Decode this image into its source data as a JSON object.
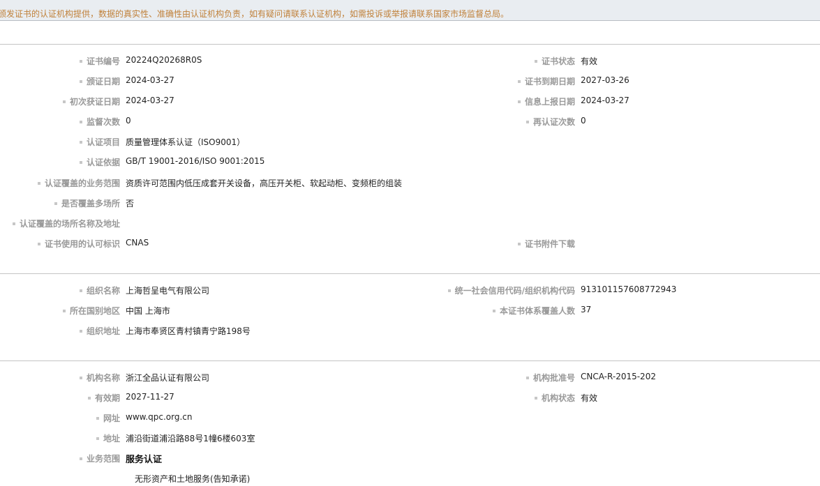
{
  "notice": "颁发证书的认证机构提供，数据的真实性、准确性由认证机构负责，如有疑问请联系认证机构，如需投诉或举报请联系国家市场监督总局。",
  "certificate": {
    "cert_no_label": "证书编号",
    "cert_no": "20224Q20268R0S",
    "status_label": "证书状态",
    "status": "有效",
    "issue_date_label": "颁证日期",
    "issue_date": "2024-03-27",
    "expiry_label": "证书到期日期",
    "expiry": "2027-03-26",
    "first_date_label": "初次获证日期",
    "first_date": "2024-03-27",
    "report_date_label": "信息上报日期",
    "report_date": "2024-03-27",
    "supervision_label": "监督次数",
    "supervision": "0",
    "recert_label": "再认证次数",
    "recert": "0",
    "project_label": "认证项目",
    "project": "质量管理体系认证（ISO9001）",
    "basis_label": "认证依据",
    "basis": "GB/T 19001-2016/ISO 9001:2015",
    "scope_label": "认证覆盖的业务范围",
    "scope": "资质许可范围内低压成套开关设备，高压开关柜、软起动柜、变频柜的组装",
    "multi_site_label": "是否覆盖多场所",
    "multi_site": "否",
    "sites_label": "认证覆盖的场所名称及地址",
    "sites": "",
    "accreditation_label": "证书使用的认可标识",
    "accreditation": "CNAS",
    "attachment_label": "证书附件下载"
  },
  "organization": {
    "name_label": "组织名称",
    "name": "上海哲呈电气有限公司",
    "credit_label": "统一社会信用代码/组织机构代码",
    "credit": "913101157608772943",
    "region_label": "所在国别地区",
    "region": "中国 上海市",
    "headcount_label": "本证书体系覆盖人数",
    "headcount": "37",
    "address_label": "组织地址",
    "address": "上海市奉贤区青村镇青宁路198号"
  },
  "agency": {
    "name_label": "机构名称",
    "name": "浙江全品认证有限公司",
    "approval_label": "机构批准号",
    "approval": "CNCA-R-2015-202",
    "valid_label": "有效期",
    "valid": "2027-11-27",
    "status_label": "机构状态",
    "status": "有效",
    "website_label": "网址",
    "website": "www.qpc.org.cn",
    "address_label": "地址",
    "address": "浦沿街道浦沿路88号1幢6楼603室",
    "scope_label": "业务范围",
    "scope_title": "服务认证",
    "scope_item": "无形资产和土地服务(告知承诺)"
  }
}
